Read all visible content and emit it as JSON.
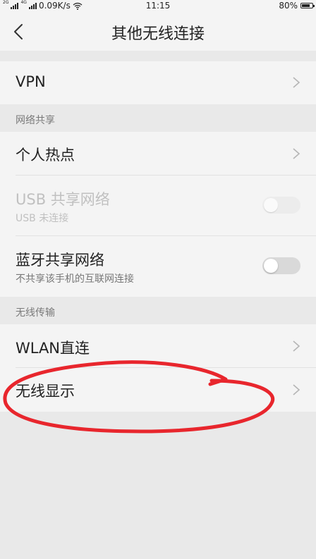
{
  "status_bar": {
    "network_left": "2G",
    "network_right": "4G",
    "speed": "0.09K/s",
    "time": "11:15",
    "battery": "80%",
    "battery_level": 0.8
  },
  "header": {
    "title": "其他无线连接",
    "back_icon": "chevron-left-icon"
  },
  "rows": {
    "vpn": {
      "label": "VPN"
    },
    "hotspot": {
      "label": "个人热点"
    },
    "usb": {
      "label": "USB 共享网络",
      "sub": "USB 未连接",
      "toggle": "off",
      "enabled": false
    },
    "bluetooth": {
      "label": "蓝牙共享网络",
      "sub": "不共享该手机的互联网连接",
      "toggle": "off",
      "enabled": true
    },
    "wlan_direct": {
      "label": "WLAN直连"
    },
    "wireless_display": {
      "label": "无线显示"
    }
  },
  "sections": {
    "network_sharing": "网络共享",
    "wireless_transfer": "无线传输"
  },
  "colors": {
    "background": "#e9e9e9",
    "row_background": "#f4f4f4",
    "annotation_red": "#e8262d"
  }
}
